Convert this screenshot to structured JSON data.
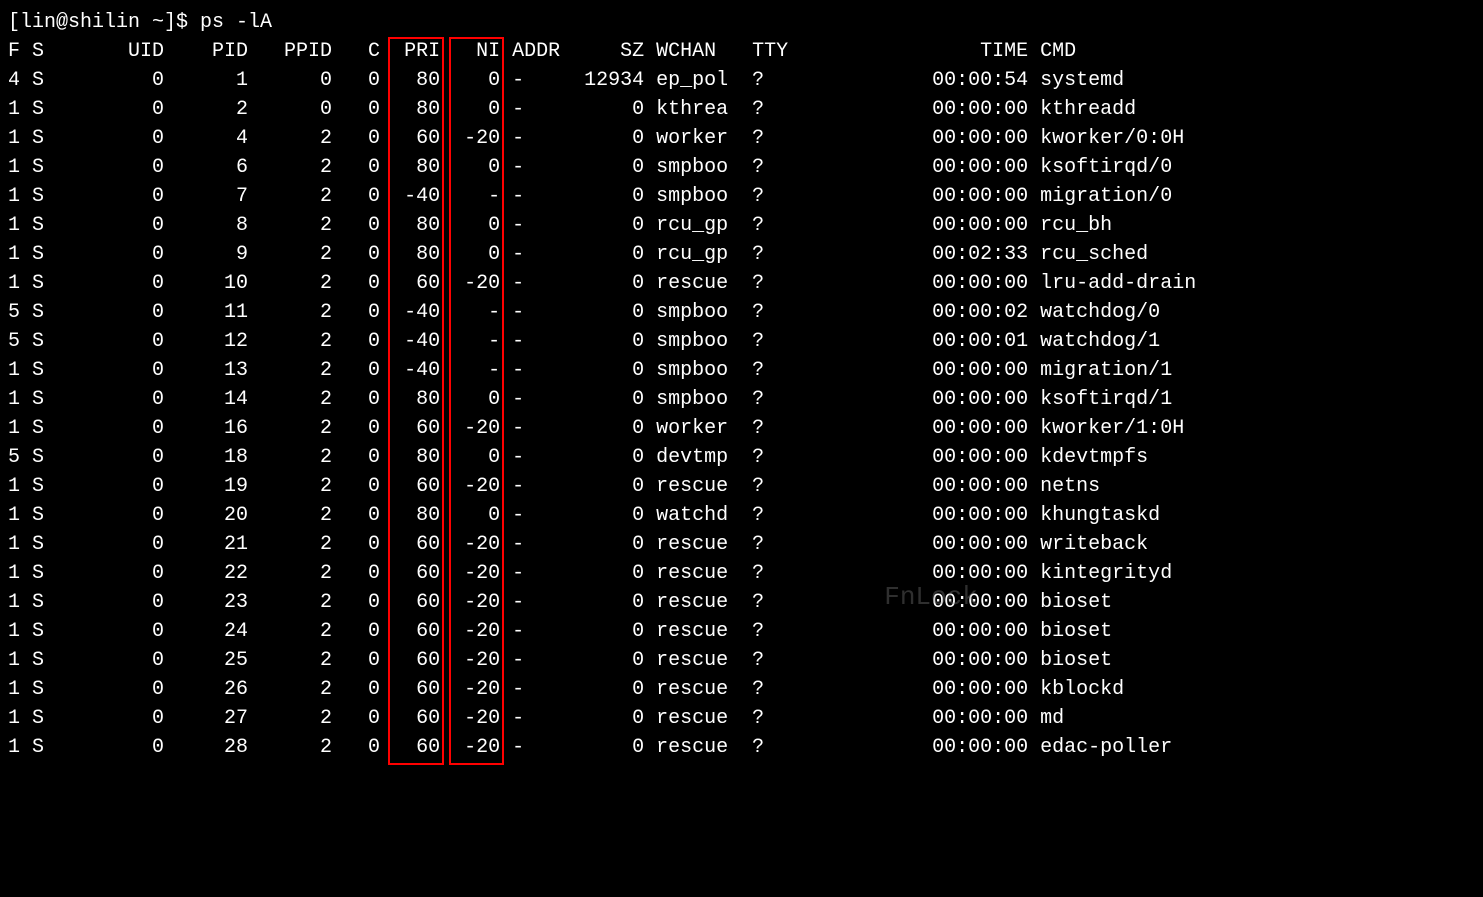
{
  "prompt": "[lin@shilin ~]$ ps -lA",
  "headers": [
    "F",
    "S",
    "UID",
    "PID",
    "PPID",
    "C",
    "PRI",
    "NI",
    "ADDR",
    "SZ",
    "WCHAN",
    "TTY",
    "TIME",
    "CMD"
  ],
  "highlight_columns": [
    "PRI",
    "NI"
  ],
  "highlight_color": "#ff0000",
  "watermark_text": "FnLock",
  "rows": [
    {
      "F": "4",
      "S": "S",
      "UID": "0",
      "PID": "1",
      "PPID": "0",
      "C": "0",
      "PRI": "80",
      "NI": "0",
      "ADDR": "-",
      "SZ": "12934",
      "WCHAN": "ep_pol",
      "TTY": "?",
      "TIME": "00:00:54",
      "CMD": "systemd"
    },
    {
      "F": "1",
      "S": "S",
      "UID": "0",
      "PID": "2",
      "PPID": "0",
      "C": "0",
      "PRI": "80",
      "NI": "0",
      "ADDR": "-",
      "SZ": "0",
      "WCHAN": "kthrea",
      "TTY": "?",
      "TIME": "00:00:00",
      "CMD": "kthreadd"
    },
    {
      "F": "1",
      "S": "S",
      "UID": "0",
      "PID": "4",
      "PPID": "2",
      "C": "0",
      "PRI": "60",
      "NI": "-20",
      "ADDR": "-",
      "SZ": "0",
      "WCHAN": "worker",
      "TTY": "?",
      "TIME": "00:00:00",
      "CMD": "kworker/0:0H"
    },
    {
      "F": "1",
      "S": "S",
      "UID": "0",
      "PID": "6",
      "PPID": "2",
      "C": "0",
      "PRI": "80",
      "NI": "0",
      "ADDR": "-",
      "SZ": "0",
      "WCHAN": "smpboo",
      "TTY": "?",
      "TIME": "00:00:00",
      "CMD": "ksoftirqd/0"
    },
    {
      "F": "1",
      "S": "S",
      "UID": "0",
      "PID": "7",
      "PPID": "2",
      "C": "0",
      "PRI": "-40",
      "NI": "-",
      "ADDR": "-",
      "SZ": "0",
      "WCHAN": "smpboo",
      "TTY": "?",
      "TIME": "00:00:00",
      "CMD": "migration/0"
    },
    {
      "F": "1",
      "S": "S",
      "UID": "0",
      "PID": "8",
      "PPID": "2",
      "C": "0",
      "PRI": "80",
      "NI": "0",
      "ADDR": "-",
      "SZ": "0",
      "WCHAN": "rcu_gp",
      "TTY": "?",
      "TIME": "00:00:00",
      "CMD": "rcu_bh"
    },
    {
      "F": "1",
      "S": "S",
      "UID": "0",
      "PID": "9",
      "PPID": "2",
      "C": "0",
      "PRI": "80",
      "NI": "0",
      "ADDR": "-",
      "SZ": "0",
      "WCHAN": "rcu_gp",
      "TTY": "?",
      "TIME": "00:02:33",
      "CMD": "rcu_sched"
    },
    {
      "F": "1",
      "S": "S",
      "UID": "0",
      "PID": "10",
      "PPID": "2",
      "C": "0",
      "PRI": "60",
      "NI": "-20",
      "ADDR": "-",
      "SZ": "0",
      "WCHAN": "rescue",
      "TTY": "?",
      "TIME": "00:00:00",
      "CMD": "lru-add-drain"
    },
    {
      "F": "5",
      "S": "S",
      "UID": "0",
      "PID": "11",
      "PPID": "2",
      "C": "0",
      "PRI": "-40",
      "NI": "-",
      "ADDR": "-",
      "SZ": "0",
      "WCHAN": "smpboo",
      "TTY": "?",
      "TIME": "00:00:02",
      "CMD": "watchdog/0"
    },
    {
      "F": "5",
      "S": "S",
      "UID": "0",
      "PID": "12",
      "PPID": "2",
      "C": "0",
      "PRI": "-40",
      "NI": "-",
      "ADDR": "-",
      "SZ": "0",
      "WCHAN": "smpboo",
      "TTY": "?",
      "TIME": "00:00:01",
      "CMD": "watchdog/1"
    },
    {
      "F": "1",
      "S": "S",
      "UID": "0",
      "PID": "13",
      "PPID": "2",
      "C": "0",
      "PRI": "-40",
      "NI": "-",
      "ADDR": "-",
      "SZ": "0",
      "WCHAN": "smpboo",
      "TTY": "?",
      "TIME": "00:00:00",
      "CMD": "migration/1"
    },
    {
      "F": "1",
      "S": "S",
      "UID": "0",
      "PID": "14",
      "PPID": "2",
      "C": "0",
      "PRI": "80",
      "NI": "0",
      "ADDR": "-",
      "SZ": "0",
      "WCHAN": "smpboo",
      "TTY": "?",
      "TIME": "00:00:00",
      "CMD": "ksoftirqd/1"
    },
    {
      "F": "1",
      "S": "S",
      "UID": "0",
      "PID": "16",
      "PPID": "2",
      "C": "0",
      "PRI": "60",
      "NI": "-20",
      "ADDR": "-",
      "SZ": "0",
      "WCHAN": "worker",
      "TTY": "?",
      "TIME": "00:00:00",
      "CMD": "kworker/1:0H"
    },
    {
      "F": "5",
      "S": "S",
      "UID": "0",
      "PID": "18",
      "PPID": "2",
      "C": "0",
      "PRI": "80",
      "NI": "0",
      "ADDR": "-",
      "SZ": "0",
      "WCHAN": "devtmp",
      "TTY": "?",
      "TIME": "00:00:00",
      "CMD": "kdevtmpfs"
    },
    {
      "F": "1",
      "S": "S",
      "UID": "0",
      "PID": "19",
      "PPID": "2",
      "C": "0",
      "PRI": "60",
      "NI": "-20",
      "ADDR": "-",
      "SZ": "0",
      "WCHAN": "rescue",
      "TTY": "?",
      "TIME": "00:00:00",
      "CMD": "netns"
    },
    {
      "F": "1",
      "S": "S",
      "UID": "0",
      "PID": "20",
      "PPID": "2",
      "C": "0",
      "PRI": "80",
      "NI": "0",
      "ADDR": "-",
      "SZ": "0",
      "WCHAN": "watchd",
      "TTY": "?",
      "TIME": "00:00:00",
      "CMD": "khungtaskd"
    },
    {
      "F": "1",
      "S": "S",
      "UID": "0",
      "PID": "21",
      "PPID": "2",
      "C": "0",
      "PRI": "60",
      "NI": "-20",
      "ADDR": "-",
      "SZ": "0",
      "WCHAN": "rescue",
      "TTY": "?",
      "TIME": "00:00:00",
      "CMD": "writeback"
    },
    {
      "F": "1",
      "S": "S",
      "UID": "0",
      "PID": "22",
      "PPID": "2",
      "C": "0",
      "PRI": "60",
      "NI": "-20",
      "ADDR": "-",
      "SZ": "0",
      "WCHAN": "rescue",
      "TTY": "?",
      "TIME": "00:00:00",
      "CMD": "kintegrityd"
    },
    {
      "F": "1",
      "S": "S",
      "UID": "0",
      "PID": "23",
      "PPID": "2",
      "C": "0",
      "PRI": "60",
      "NI": "-20",
      "ADDR": "-",
      "SZ": "0",
      "WCHAN": "rescue",
      "TTY": "?",
      "TIME": "00:00:00",
      "CMD": "bioset"
    },
    {
      "F": "1",
      "S": "S",
      "UID": "0",
      "PID": "24",
      "PPID": "2",
      "C": "0",
      "PRI": "60",
      "NI": "-20",
      "ADDR": "-",
      "SZ": "0",
      "WCHAN": "rescue",
      "TTY": "?",
      "TIME": "00:00:00",
      "CMD": "bioset"
    },
    {
      "F": "1",
      "S": "S",
      "UID": "0",
      "PID": "25",
      "PPID": "2",
      "C": "0",
      "PRI": "60",
      "NI": "-20",
      "ADDR": "-",
      "SZ": "0",
      "WCHAN": "rescue",
      "TTY": "?",
      "TIME": "00:00:00",
      "CMD": "bioset"
    },
    {
      "F": "1",
      "S": "S",
      "UID": "0",
      "PID": "26",
      "PPID": "2",
      "C": "0",
      "PRI": "60",
      "NI": "-20",
      "ADDR": "-",
      "SZ": "0",
      "WCHAN": "rescue",
      "TTY": "?",
      "TIME": "00:00:00",
      "CMD": "kblockd"
    },
    {
      "F": "1",
      "S": "S",
      "UID": "0",
      "PID": "27",
      "PPID": "2",
      "C": "0",
      "PRI": "60",
      "NI": "-20",
      "ADDR": "-",
      "SZ": "0",
      "WCHAN": "rescue",
      "TTY": "?",
      "TIME": "00:00:00",
      "CMD": "md"
    },
    {
      "F": "1",
      "S": "S",
      "UID": "0",
      "PID": "28",
      "PPID": "2",
      "C": "0",
      "PRI": "60",
      "NI": "-20",
      "ADDR": "-",
      "SZ": "0",
      "WCHAN": "rescue",
      "TTY": "?",
      "TIME": "00:00:00",
      "CMD": "edac-poller"
    }
  ]
}
